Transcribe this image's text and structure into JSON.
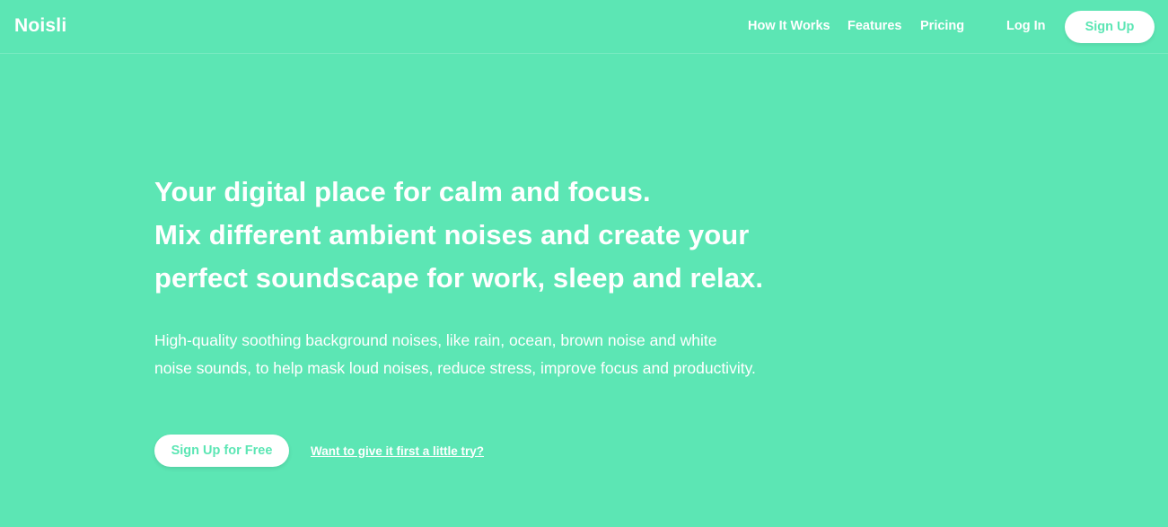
{
  "header": {
    "logo": "Noisli",
    "nav": {
      "how_it_works": "How It Works",
      "features": "Features",
      "pricing": "Pricing",
      "login": "Log In",
      "signup": "Sign Up"
    }
  },
  "hero": {
    "headline_lines": [
      "Your digital place for calm and focus.",
      "Mix different ambient noises and create your",
      "perfect soundscape for work, sleep and relax."
    ],
    "subtext_lines": [
      "High-quality soothing background noises, like rain, ocean, brown noise and white",
      "noise sounds, to help mask loud noises, reduce stress, improve focus and productivity."
    ],
    "cta_label": "Sign Up for Free",
    "try_link": "Want to give it first a little try?"
  },
  "colors": {
    "brand": "#5ce6b4",
    "text": "#ffffff"
  }
}
